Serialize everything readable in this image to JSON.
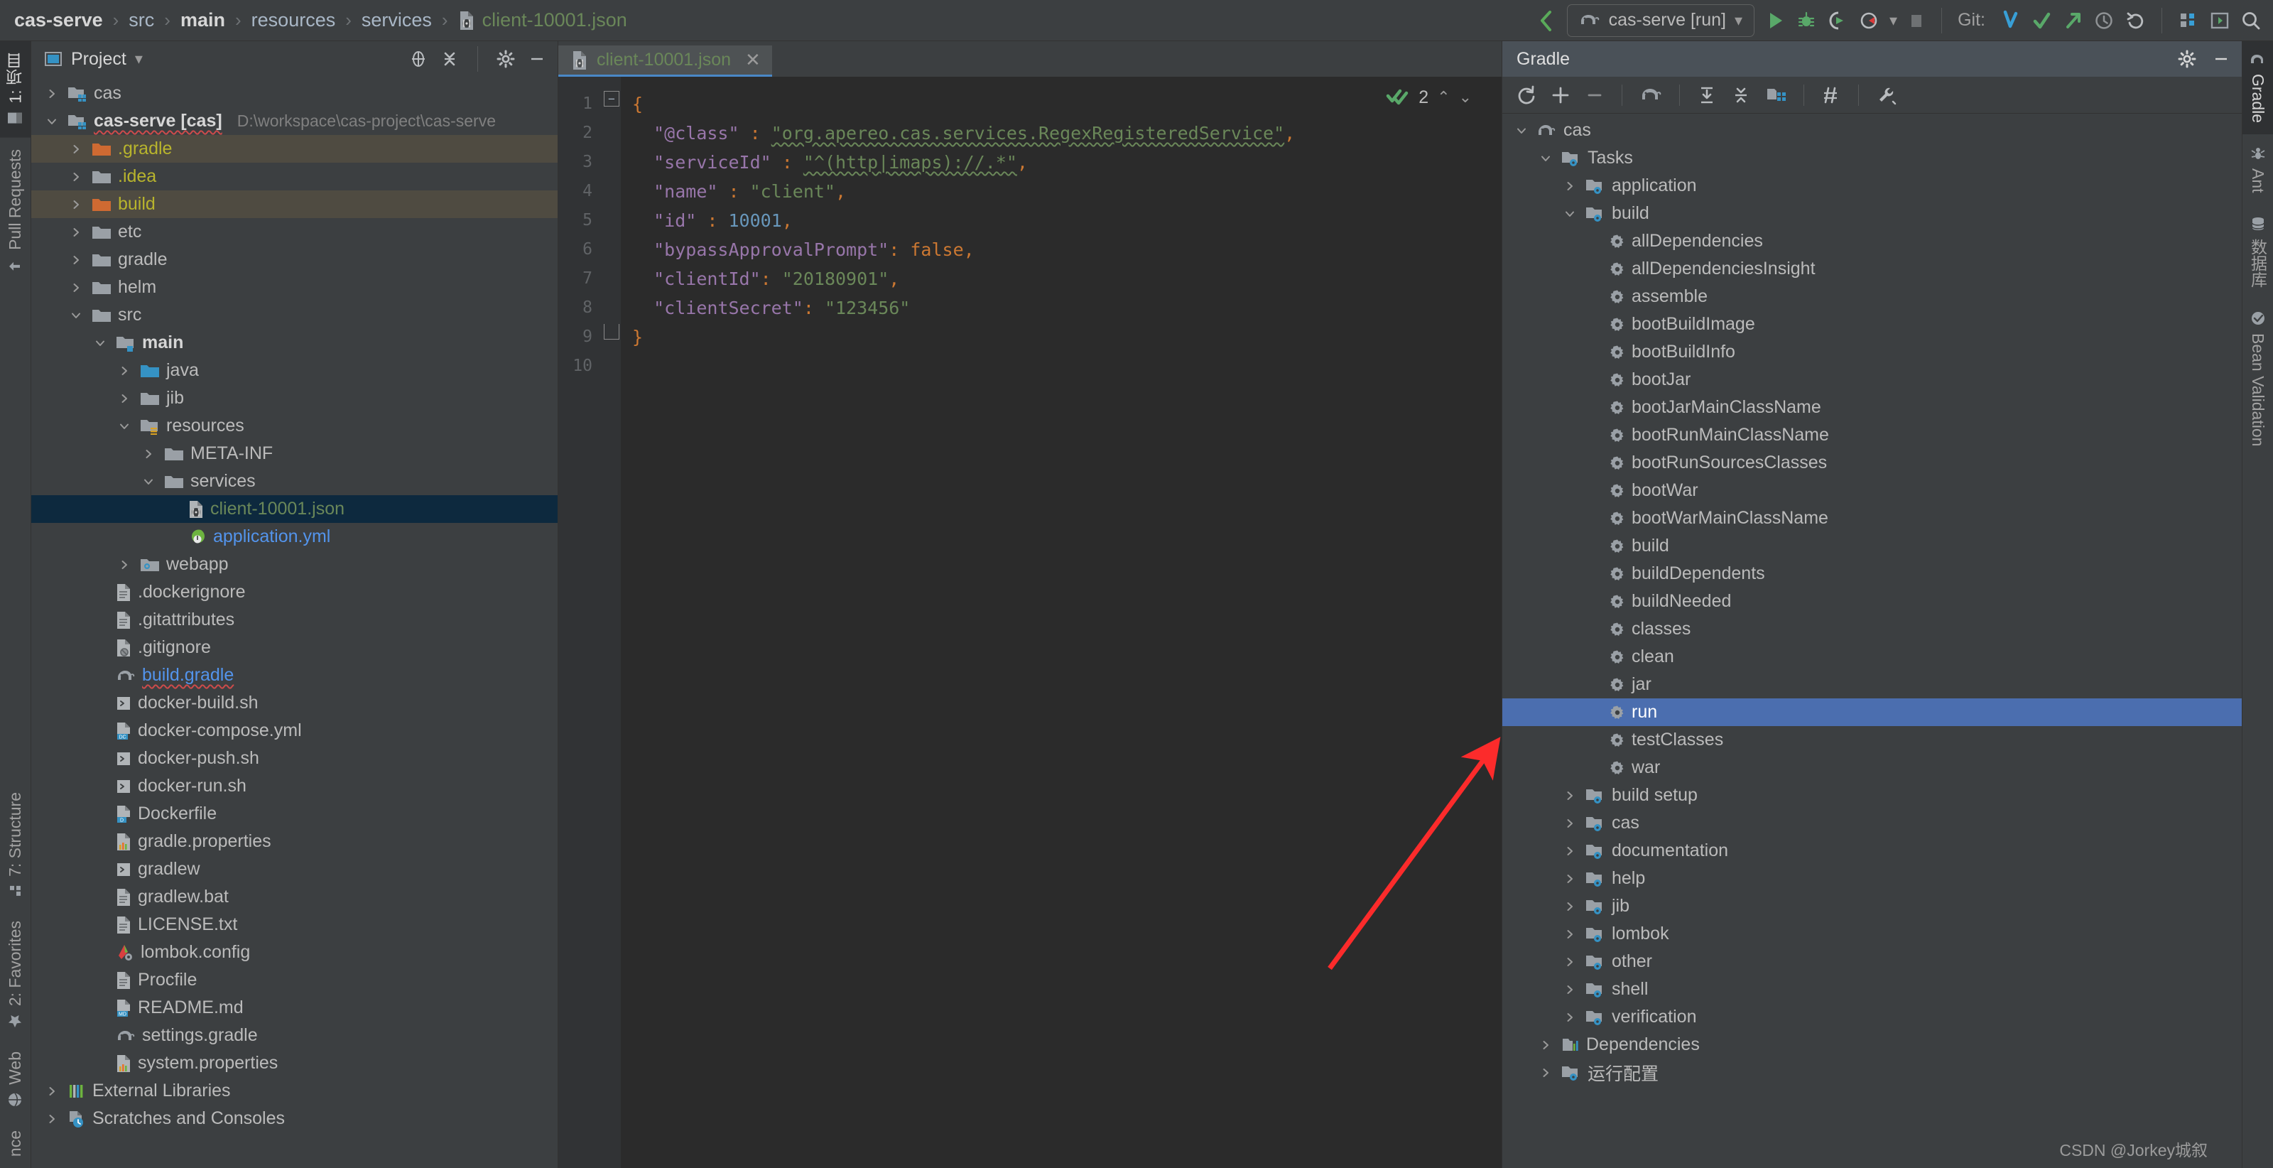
{
  "breadcrumb": {
    "items": [
      {
        "label": "cas-serve",
        "style": "bold"
      },
      {
        "label": "src",
        "style": "normal"
      },
      {
        "label": "main",
        "style": "bold"
      },
      {
        "label": "resources",
        "style": "normal"
      },
      {
        "label": "services",
        "style": "normal"
      },
      {
        "label": "client-10001.json",
        "style": "green"
      }
    ],
    "separator": "›"
  },
  "toolbar": {
    "run_config": "cas-serve [run]",
    "git_label": "Git:",
    "icons": [
      "back-arrow-icon",
      "run-icon",
      "debug-icon",
      "run-with-coverage-icon",
      "profiler-icon",
      "stop-icon",
      "git-update-icon",
      "git-commit-icon",
      "git-push-icon",
      "git-history-icon",
      "git-rollback-icon",
      "structure-icon",
      "terminal-icon",
      "search-everywhere-icon"
    ]
  },
  "left_strip": {
    "top_tabs": [
      {
        "label": "1: 项目",
        "icon": "project-icon",
        "active": true
      },
      {
        "label": "Pull Requests",
        "icon": "pull-request-icon",
        "active": false
      }
    ],
    "bottom_tabs": [
      {
        "label": "7: Structure",
        "icon": "structure-icon"
      },
      {
        "label": "2: Favorites",
        "icon": "star-icon"
      },
      {
        "label": "Web",
        "icon": "web-icon"
      },
      {
        "label": "nce",
        "icon": "none"
      }
    ]
  },
  "right_strip": {
    "tabs": [
      {
        "label": "Gradle",
        "icon": "gradle-elephant-icon",
        "active": true
      },
      {
        "label": "Ant",
        "icon": "ant-icon",
        "active": false
      },
      {
        "label": "数据库",
        "icon": "database-icon",
        "active": false
      },
      {
        "label": "Bean Validation",
        "icon": "bean-icon",
        "active": false
      }
    ]
  },
  "project_panel": {
    "title": "Project",
    "dropdown_icon": "chevron-down-icon",
    "actions": [
      "locate-icon",
      "collapse-all-icon",
      "gear-icon",
      "minimize-icon"
    ],
    "tree": [
      {
        "depth": 0,
        "arrow": "right",
        "icon": "module-folder",
        "label": "cas",
        "style": "normal"
      },
      {
        "depth": 0,
        "arrow": "down",
        "icon": "module-folder",
        "label": "cas-serve [cas]",
        "style": "bold-wavy",
        "path": "D:\\workspace\\cas-project\\cas-serve"
      },
      {
        "depth": 1,
        "arrow": "right",
        "icon": "folder-orange",
        "label": ".gradle",
        "style": "yellow",
        "highlight": "mark"
      },
      {
        "depth": 1,
        "arrow": "right",
        "icon": "folder-gray",
        "label": ".idea",
        "style": "yellow"
      },
      {
        "depth": 1,
        "arrow": "right",
        "icon": "folder-orange",
        "label": "build",
        "style": "yellow",
        "highlight": "mark"
      },
      {
        "depth": 1,
        "arrow": "right",
        "icon": "folder-gray",
        "label": "etc",
        "style": "normal"
      },
      {
        "depth": 1,
        "arrow": "right",
        "icon": "folder-gray",
        "label": "gradle",
        "style": "normal"
      },
      {
        "depth": 1,
        "arrow": "right",
        "icon": "folder-gray",
        "label": "helm",
        "style": "normal"
      },
      {
        "depth": 1,
        "arrow": "down",
        "icon": "folder-gray",
        "label": "src",
        "style": "normal"
      },
      {
        "depth": 2,
        "arrow": "down",
        "icon": "folder-source-root",
        "label": "main",
        "style": "bold"
      },
      {
        "depth": 3,
        "arrow": "right",
        "icon": "folder-blue",
        "label": "java",
        "style": "normal"
      },
      {
        "depth": 3,
        "arrow": "right",
        "icon": "folder-gray",
        "label": "jib",
        "style": "normal"
      },
      {
        "depth": 3,
        "arrow": "down",
        "icon": "folder-resource-root",
        "label": "resources",
        "style": "normal"
      },
      {
        "depth": 4,
        "arrow": "right",
        "icon": "folder-gray",
        "label": "META-INF",
        "style": "normal"
      },
      {
        "depth": 4,
        "arrow": "down",
        "icon": "folder-gray",
        "label": "services",
        "style": "normal"
      },
      {
        "depth": 5,
        "arrow": "none",
        "icon": "json-file",
        "label": "client-10001.json",
        "style": "green",
        "highlight": "selected"
      },
      {
        "depth": 5,
        "arrow": "none",
        "icon": "spring-yml-file",
        "label": "application.yml",
        "style": "blue"
      },
      {
        "depth": 3,
        "arrow": "right",
        "icon": "folder-webapp",
        "label": "webapp",
        "style": "normal"
      },
      {
        "depth": 2,
        "arrow": "none",
        "icon": "text-file",
        "label": ".dockerignore",
        "style": "normal"
      },
      {
        "depth": 2,
        "arrow": "none",
        "icon": "text-file",
        "label": ".gitattributes",
        "style": "normal"
      },
      {
        "depth": 2,
        "arrow": "none",
        "icon": "ignore-file",
        "label": ".gitignore",
        "style": "normal"
      },
      {
        "depth": 2,
        "arrow": "none",
        "icon": "gradle-file",
        "label": "build.gradle",
        "style": "blue-wavy"
      },
      {
        "depth": 2,
        "arrow": "none",
        "icon": "shell-file",
        "label": "docker-build.sh",
        "style": "normal"
      },
      {
        "depth": 2,
        "arrow": "none",
        "icon": "docker-compose-file",
        "label": "docker-compose.yml",
        "style": "normal"
      },
      {
        "depth": 2,
        "arrow": "none",
        "icon": "shell-file",
        "label": "docker-push.sh",
        "style": "normal"
      },
      {
        "depth": 2,
        "arrow": "none",
        "icon": "shell-file",
        "label": "docker-run.sh",
        "style": "normal"
      },
      {
        "depth": 2,
        "arrow": "none",
        "icon": "dockerfile-file",
        "label": "Dockerfile",
        "style": "normal"
      },
      {
        "depth": 2,
        "arrow": "none",
        "icon": "properties-file",
        "label": "gradle.properties",
        "style": "normal"
      },
      {
        "depth": 2,
        "arrow": "none",
        "icon": "shell-file",
        "label": "gradlew",
        "style": "normal"
      },
      {
        "depth": 2,
        "arrow": "none",
        "icon": "text-file",
        "label": "gradlew.bat",
        "style": "normal"
      },
      {
        "depth": 2,
        "arrow": "none",
        "icon": "text-file",
        "label": "LICENSE.txt",
        "style": "normal"
      },
      {
        "depth": 2,
        "arrow": "none",
        "icon": "lombok-file",
        "label": "lombok.config",
        "style": "normal"
      },
      {
        "depth": 2,
        "arrow": "none",
        "icon": "text-file",
        "label": "Procfile",
        "style": "normal"
      },
      {
        "depth": 2,
        "arrow": "none",
        "icon": "markdown-file",
        "label": "README.md",
        "style": "normal"
      },
      {
        "depth": 2,
        "arrow": "none",
        "icon": "gradle-file",
        "label": "settings.gradle",
        "style": "normal"
      },
      {
        "depth": 2,
        "arrow": "none",
        "icon": "properties-file",
        "label": "system.properties",
        "style": "normal"
      },
      {
        "depth": 0,
        "arrow": "right",
        "icon": "libraries-icon",
        "label": "External Libraries",
        "style": "normal"
      },
      {
        "depth": 0,
        "arrow": "right",
        "icon": "scratches-icon",
        "label": "Scratches and Consoles",
        "style": "normal"
      }
    ]
  },
  "editor": {
    "tab": {
      "label": "client-10001.json",
      "icon": "json-file",
      "close_icon": "close-icon"
    },
    "inspection": {
      "count": "2",
      "icon": "inspection-ok-icon",
      "up_icon": "chevron-up-icon",
      "down_icon": "chevron-down-icon"
    },
    "line_numbers": [
      "1",
      "2",
      "3",
      "4",
      "5",
      "6",
      "7",
      "8",
      "9",
      "10"
    ],
    "code_lines": [
      [
        {
          "t": "{",
          "c": "br"
        }
      ],
      [
        {
          "t": "  ",
          "c": "p"
        },
        {
          "t": "\"@class\"",
          "c": "key"
        },
        {
          "t": " : ",
          "c": "p"
        },
        {
          "t": "\"org.apereo.cas.services.RegexRegisteredService\"",
          "c": "str-sq"
        },
        {
          "t": ",",
          "c": "p"
        }
      ],
      [
        {
          "t": "  ",
          "c": "p"
        },
        {
          "t": "\"serviceId\"",
          "c": "key"
        },
        {
          "t": " : ",
          "c": "p"
        },
        {
          "t": "\"^(http|imaps)://.*\"",
          "c": "str-sq2"
        },
        {
          "t": ",",
          "c": "p"
        }
      ],
      [
        {
          "t": "  ",
          "c": "p"
        },
        {
          "t": "\"name\"",
          "c": "key"
        },
        {
          "t": " : ",
          "c": "p"
        },
        {
          "t": "\"client\"",
          "c": "str"
        },
        {
          "t": ",",
          "c": "p"
        }
      ],
      [
        {
          "t": "  ",
          "c": "p"
        },
        {
          "t": "\"id\"",
          "c": "key"
        },
        {
          "t": " : ",
          "c": "p"
        },
        {
          "t": "10001",
          "c": "num"
        },
        {
          "t": ",",
          "c": "p"
        }
      ],
      [
        {
          "t": "  ",
          "c": "p"
        },
        {
          "t": "\"bypassApprovalPrompt\"",
          "c": "key"
        },
        {
          "t": ": ",
          "c": "p"
        },
        {
          "t": "false",
          "c": "kw"
        },
        {
          "t": ",",
          "c": "p"
        }
      ],
      [
        {
          "t": "  ",
          "c": "p"
        },
        {
          "t": "\"clientId\"",
          "c": "key"
        },
        {
          "t": ": ",
          "c": "p"
        },
        {
          "t": "\"20180901\"",
          "c": "str"
        },
        {
          "t": ",",
          "c": "p"
        }
      ],
      [
        {
          "t": "  ",
          "c": "p"
        },
        {
          "t": "\"clientSecret\"",
          "c": "key"
        },
        {
          "t": ": ",
          "c": "p"
        },
        {
          "t": "\"123456\"",
          "c": "str"
        }
      ],
      [
        {
          "t": "}",
          "c": "br"
        }
      ],
      []
    ]
  },
  "gradle_panel": {
    "title": "Gradle",
    "head_actions": [
      "gear-icon",
      "minimize-icon"
    ],
    "toolbar_icons": [
      "refresh-icon",
      "add-icon",
      "remove-icon",
      "gradle-elephant-icon",
      "expand-all-icon",
      "collapse-all-icon",
      "task-filter-icon",
      "toggle-offline-icon",
      "wrench-icon"
    ],
    "tree": [
      {
        "depth": 0,
        "arrow": "down",
        "icon": "gradle-elephant-icon",
        "label": "cas"
      },
      {
        "depth": 1,
        "arrow": "down",
        "icon": "task-folder-icon",
        "label": "Tasks"
      },
      {
        "depth": 2,
        "arrow": "right",
        "icon": "task-folder-icon",
        "label": "application"
      },
      {
        "depth": 2,
        "arrow": "down",
        "icon": "task-folder-icon",
        "label": "build"
      },
      {
        "depth": 3,
        "arrow": "none",
        "icon": "gear-task-icon",
        "label": "allDependencies"
      },
      {
        "depth": 3,
        "arrow": "none",
        "icon": "gear-task-icon",
        "label": "allDependenciesInsight"
      },
      {
        "depth": 3,
        "arrow": "none",
        "icon": "gear-task-icon",
        "label": "assemble"
      },
      {
        "depth": 3,
        "arrow": "none",
        "icon": "gear-task-icon",
        "label": "bootBuildImage"
      },
      {
        "depth": 3,
        "arrow": "none",
        "icon": "gear-task-icon",
        "label": "bootBuildInfo"
      },
      {
        "depth": 3,
        "arrow": "none",
        "icon": "gear-task-icon",
        "label": "bootJar"
      },
      {
        "depth": 3,
        "arrow": "none",
        "icon": "gear-task-icon",
        "label": "bootJarMainClassName"
      },
      {
        "depth": 3,
        "arrow": "none",
        "icon": "gear-task-icon",
        "label": "bootRunMainClassName"
      },
      {
        "depth": 3,
        "arrow": "none",
        "icon": "gear-task-icon",
        "label": "bootRunSourcesClasses"
      },
      {
        "depth": 3,
        "arrow": "none",
        "icon": "gear-task-icon",
        "label": "bootWar"
      },
      {
        "depth": 3,
        "arrow": "none",
        "icon": "gear-task-icon",
        "label": "bootWarMainClassName"
      },
      {
        "depth": 3,
        "arrow": "none",
        "icon": "gear-task-icon",
        "label": "build"
      },
      {
        "depth": 3,
        "arrow": "none",
        "icon": "gear-task-icon",
        "label": "buildDependents"
      },
      {
        "depth": 3,
        "arrow": "none",
        "icon": "gear-task-icon",
        "label": "buildNeeded"
      },
      {
        "depth": 3,
        "arrow": "none",
        "icon": "gear-task-icon",
        "label": "classes"
      },
      {
        "depth": 3,
        "arrow": "none",
        "icon": "gear-task-icon",
        "label": "clean"
      },
      {
        "depth": 3,
        "arrow": "none",
        "icon": "gear-task-icon",
        "label": "jar"
      },
      {
        "depth": 3,
        "arrow": "none",
        "icon": "gear-task-icon",
        "label": "run",
        "selected": true
      },
      {
        "depth": 3,
        "arrow": "none",
        "icon": "gear-task-icon",
        "label": "testClasses"
      },
      {
        "depth": 3,
        "arrow": "none",
        "icon": "gear-task-icon",
        "label": "war"
      },
      {
        "depth": 2,
        "arrow": "right",
        "icon": "task-folder-icon",
        "label": "build setup"
      },
      {
        "depth": 2,
        "arrow": "right",
        "icon": "task-folder-icon",
        "label": "cas"
      },
      {
        "depth": 2,
        "arrow": "right",
        "icon": "task-folder-icon",
        "label": "documentation"
      },
      {
        "depth": 2,
        "arrow": "right",
        "icon": "task-folder-icon",
        "label": "help"
      },
      {
        "depth": 2,
        "arrow": "right",
        "icon": "task-folder-icon",
        "label": "jib"
      },
      {
        "depth": 2,
        "arrow": "right",
        "icon": "task-folder-icon",
        "label": "lombok"
      },
      {
        "depth": 2,
        "arrow": "right",
        "icon": "task-folder-icon",
        "label": "other"
      },
      {
        "depth": 2,
        "arrow": "right",
        "icon": "task-folder-icon",
        "label": "shell"
      },
      {
        "depth": 2,
        "arrow": "right",
        "icon": "task-folder-icon",
        "label": "verification"
      },
      {
        "depth": 1,
        "arrow": "right",
        "icon": "dependencies-icon",
        "label": "Dependencies"
      },
      {
        "depth": 1,
        "arrow": "right",
        "icon": "task-folder-icon",
        "label": "运行配置"
      }
    ]
  },
  "annotation": {
    "type": "red-arrow",
    "color": "#fc2b2b"
  },
  "watermark": "CSDN @Jorkey城叙",
  "colors": {
    "background": "#3c3f41",
    "editor_background": "#2b2b2b",
    "selection_blue": "#4b6eaf",
    "tree_selection": "#0d293e",
    "accent_green": "#6a8759",
    "accent_purple": "#9876aa",
    "accent_orange": "#cc7832",
    "accent_number": "#6897bb",
    "gradle_header": "#4a5158"
  }
}
